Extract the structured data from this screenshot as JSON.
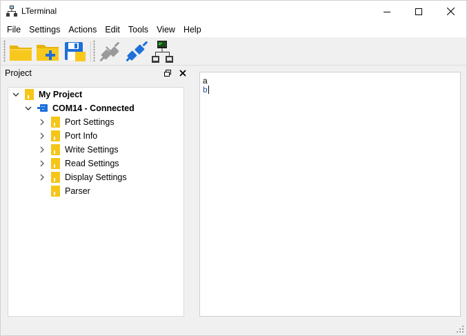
{
  "window": {
    "title": "LTerminal"
  },
  "menu": [
    "File",
    "Settings",
    "Actions",
    "Edit",
    "Tools",
    "View",
    "Help"
  ],
  "toolbar": {
    "buttons": [
      {
        "icon": "open-folder-icon"
      },
      {
        "icon": "new-project-icon"
      },
      {
        "icon": "save-icon"
      },
      {
        "icon": "disconnect-icon"
      },
      {
        "icon": "connect-icon"
      },
      {
        "icon": "network-terminal-icon"
      }
    ]
  },
  "project_panel": {
    "title": "Project",
    "tree": {
      "root": "My Project",
      "port": "COM14 - Connected",
      "children": [
        "Port Settings",
        "Port Info",
        "Write Settings",
        "Read Settings",
        "Display Settings",
        "Parser"
      ]
    }
  },
  "terminal": {
    "lines": [
      "a",
      "b"
    ]
  },
  "colors": {
    "folder": "#f5c518",
    "accent": "#1e6fd9"
  }
}
